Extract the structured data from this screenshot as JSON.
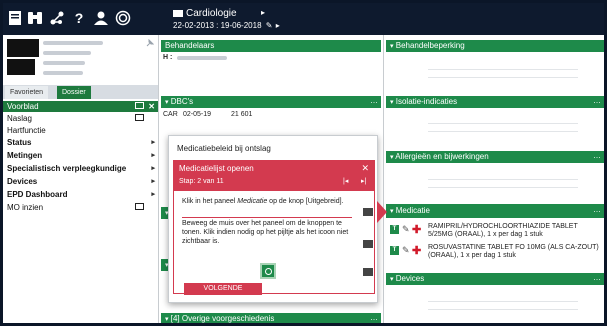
{
  "topbar": {
    "department": "Cardiologie",
    "dates": "22-02-2013 : 19-06-2018"
  },
  "sidebar": {
    "tabs": [
      {
        "label": "Favorieten"
      },
      {
        "label": "Dossier"
      }
    ],
    "items": [
      {
        "label": "Voorblad"
      },
      {
        "label": "Naslag"
      },
      {
        "label": "Hartfunctie"
      },
      {
        "label": "Status"
      },
      {
        "label": "Metingen"
      },
      {
        "label": "Specialistisch verpleegkundige"
      },
      {
        "label": "Devices"
      },
      {
        "label": "EPD Dashboard"
      },
      {
        "label": "MO inzien"
      }
    ]
  },
  "panels": {
    "behandelaars": {
      "title": "Behandelaars",
      "row_label": "H :"
    },
    "behandelbeperking": {
      "title": "Behandelbeperking"
    },
    "dbcs": {
      "title": "DBC's",
      "row": {
        "code": "CAR",
        "date": "02-05-19",
        "number": "21 601"
      }
    },
    "isolatie": {
      "title": "Isolatie-indicaties"
    },
    "allergie": {
      "title": "Allergieën en bijwerkingen"
    },
    "medicatie": {
      "title": "Medicatie",
      "items": [
        {
          "text": "RAMIPRIL/HYDROCHLOORTHIAZIDE TABLET 5/25MG (ORAAL), 1 x per dag 1 stuk"
        },
        {
          "text": "ROSUVASTATINE TABLET FO 10MG (ALS CA-ZOUT) (ORAAL), 1 x per dag 1 stuk"
        }
      ]
    },
    "devices": {
      "title": "Devices"
    },
    "voorgeschiedenis": {
      "title": "[4] Overige voorgeschiedenis"
    }
  },
  "popup": {
    "title": "Medicatiebeleid bij ontslag",
    "tutorial_title": "Medicatielijst openen",
    "step": "Stap: 2 van 11",
    "text1": "Klik in het paneel Medicatie op de knop [Uitgebreid].",
    "text1_prefix": "Klik in het paneel ",
    "text1_em": "Medicatie",
    "text1_suffix": " op de knop [Uitgebreid].",
    "text2": "Beweeg de muis over het paneel om de knoppen te tonen. Klik indien nodig op het pijltje als het icoon niet zichtbaar is.",
    "next_label": "VOLGENDE"
  },
  "colors": {
    "green": "#1e8a4a",
    "red": "#d33a4f",
    "dark": "#0e1a2e"
  }
}
